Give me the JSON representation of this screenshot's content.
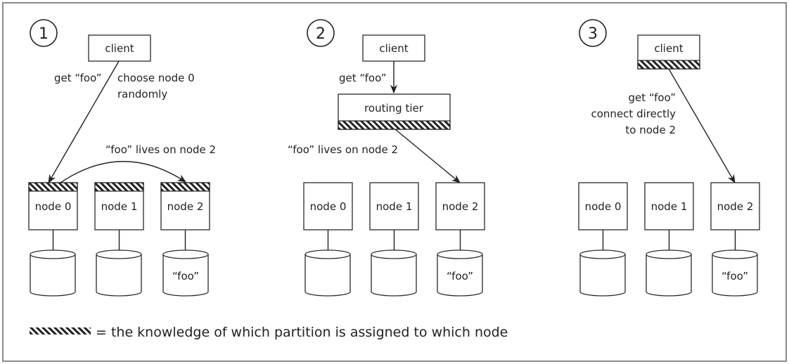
{
  "panels": [
    {
      "number": "1",
      "client_label": "client",
      "client_has_knowledge": true,
      "request_label": "get “foo”",
      "note_lines": [
        "choose node 0",
        "randomly"
      ],
      "forward_label": "“foo” lives on node 2",
      "nodes": [
        {
          "label": "node 0",
          "has_knowledge": true,
          "db_label": ""
        },
        {
          "label": "node 1",
          "has_knowledge": true,
          "db_label": ""
        },
        {
          "label": "node 2",
          "has_knowledge": true,
          "db_label": "“foo”"
        }
      ]
    },
    {
      "number": "2",
      "client_label": "client",
      "request_label": "get “foo”",
      "router_label": "routing tier",
      "forward_label": "“foo” lives on node 2",
      "nodes": [
        {
          "label": "node 0",
          "has_knowledge": false,
          "db_label": ""
        },
        {
          "label": "node 1",
          "has_knowledge": false,
          "db_label": ""
        },
        {
          "label": "node 2",
          "has_knowledge": false,
          "db_label": "“foo”"
        }
      ]
    },
    {
      "number": "3",
      "client_label": "client",
      "request_lines": [
        "get “foo”",
        "connect directly",
        "to node 2"
      ],
      "nodes": [
        {
          "label": "node 0",
          "has_knowledge": false,
          "db_label": ""
        },
        {
          "label": "node 1",
          "has_knowledge": false,
          "db_label": ""
        },
        {
          "label": "node 2",
          "has_knowledge": false,
          "db_label": "“foo”"
        }
      ]
    }
  ],
  "legend": {
    "text": "= the knowledge of which partition is assigned to which node"
  }
}
